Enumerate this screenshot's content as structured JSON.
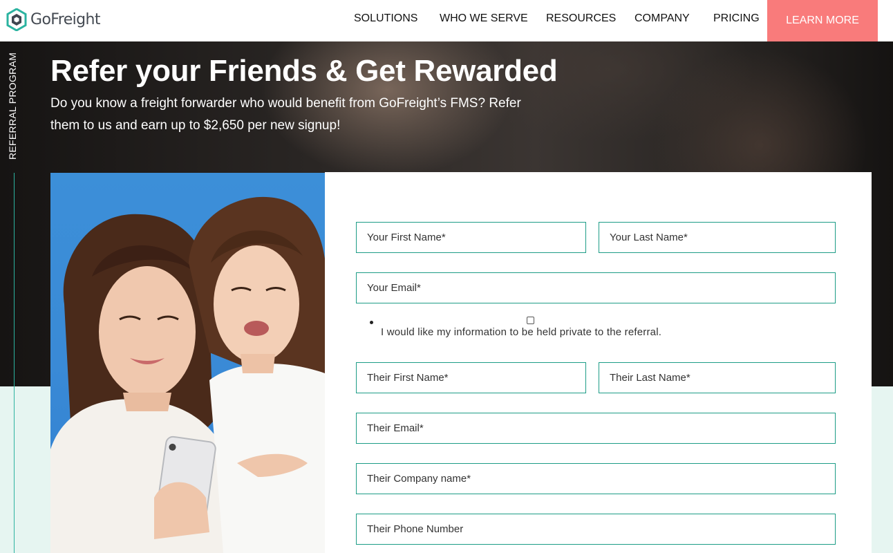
{
  "brand": {
    "name": "GoFreight",
    "colors": {
      "accent": "#f97b7b",
      "teal": "#1c9c86",
      "logo_teal": "#2bb3a0",
      "logo_dark": "#3f4650"
    }
  },
  "nav": {
    "items": [
      {
        "label": "SOLUTIONS"
      },
      {
        "label": "WHO WE SERVE"
      },
      {
        "label": "RESOURCES"
      },
      {
        "label": "COMPANY"
      },
      {
        "label": "PRICING"
      }
    ],
    "cta_label": "LEARN MORE"
  },
  "hero": {
    "side_label": "REFERRAL PROGRAM",
    "title": "Refer your Friends & Get Rewarded",
    "subtitle": "Do you know a freight forwarder who would benefit from GoFreight’s FMS? Refer them to us and earn up to $2,650 per new signup!"
  },
  "form": {
    "your_first_name": "Your First Name*",
    "your_last_name": "Your Last Name*",
    "your_email": "Your Email*",
    "privacy_label": "I would like my information to be held private to the referral.",
    "privacy_checked": false,
    "their_first_name": "Their First Name*",
    "their_last_name": "Their Last Name*",
    "their_email": "Their Email*",
    "their_company": "Their Company name*",
    "their_phone": "Their Phone Number"
  }
}
